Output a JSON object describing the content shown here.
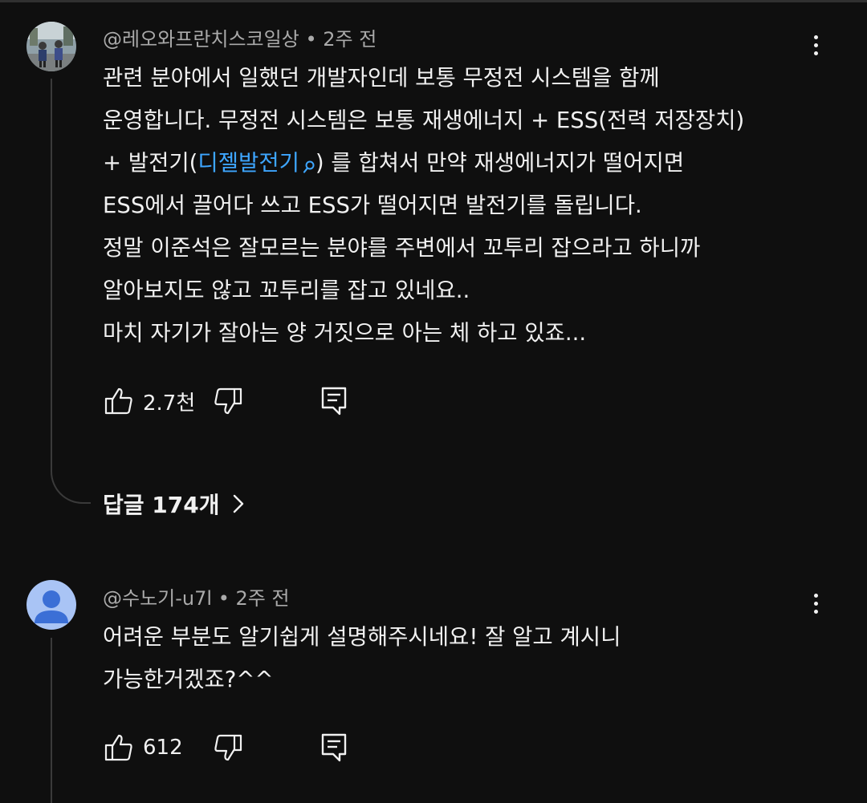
{
  "comments": [
    {
      "author": "@레오와프란치스코일상",
      "separator": "•",
      "time": "2주 전",
      "body_lines": [
        "관련 분야에서 일했던 개발자인데 보통 무정전 시스템을 함께",
        "운영합니다. 무정전 시스템은 보통 재생에너지 + ESS(전력 저장장치)"
      ],
      "line3_before": "+ 발전기(",
      "line3_link": "디젤발전기",
      "line3_after": ") 를 합쳐서 만약 재생에너지가 떨어지면",
      "body_lines_rest": [
        "ESS에서 끌어다 쓰고 ESS가 떨어지면 발전기를 돌립니다.",
        "정말 이준석은 잘모르는 분야를 주변에서 꼬투리 잡으라고 하니까",
        "알아보지도 않고 꼬투리를 잡고 있네요..",
        "마치 자기가 잘아는 양 거짓으로 아는 체 하고 있죠..."
      ],
      "likes": "2.7천",
      "replies_label": "답글 174개"
    },
    {
      "author": "@수노기-u7l",
      "separator": "•",
      "time": "2주 전",
      "body_lines": [
        "어려운 부분도 알기쉽게 설명해주시네요! 잘 알고 계시니",
        "가능한거겠죠?^^"
      ],
      "likes": "612"
    }
  ],
  "icons": {
    "more": "more-vert-icon",
    "like": "thumb-up-icon",
    "dislike": "thumb-down-icon",
    "reply": "comment-icon",
    "search": "search-icon",
    "chevron": "chevron-right-icon"
  },
  "colors": {
    "background": "#0f0f0f",
    "text": "#f1f1f1",
    "secondary": "#aaaaaa",
    "link": "#3ea6ff",
    "default_avatar": "#a9c4f5"
  }
}
